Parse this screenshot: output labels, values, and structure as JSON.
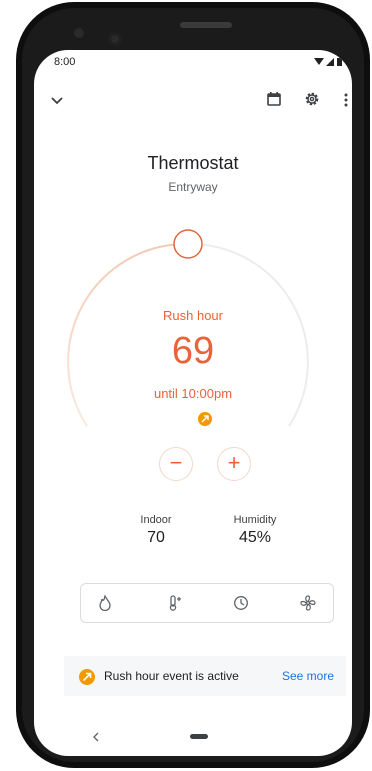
{
  "status_bar": {
    "time": "8:00"
  },
  "toolbar": {
    "collapse_icon": "chevron-down-icon",
    "calendar_icon": "calendar-icon",
    "settings_icon": "gear-icon",
    "more_icon": "more-vert-icon"
  },
  "header": {
    "title": "Thermostat",
    "subtitle": "Entryway"
  },
  "dial": {
    "mode_label": "Rush hour",
    "target_temperature": "69",
    "until_text": "until 10:00pm",
    "eco_icon": "rush-hour-leaf-icon"
  },
  "controls": {
    "decrease_label": "−",
    "increase_label": "+"
  },
  "stats": {
    "indoor_label": "Indoor",
    "indoor_value": "70",
    "humidity_label": "Humidity",
    "humidity_value": "45%"
  },
  "modes": [
    "heat-icon",
    "heat-cool-icon",
    "schedule-icon",
    "fan-icon"
  ],
  "banner": {
    "text": "Rush hour event is active",
    "link": "See more"
  },
  "colors": {
    "accent": "#e8633a",
    "link": "#1a73e8",
    "eco": "#f29900"
  }
}
